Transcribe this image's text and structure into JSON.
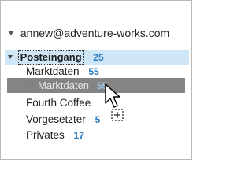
{
  "account": {
    "email": "annew@adventure-works.com",
    "expand_icon": "chevron-down-icon"
  },
  "inbox": {
    "label": "Posteingang",
    "count": "25",
    "selected": true,
    "highlight_color": "#cfe6f7"
  },
  "folders": [
    {
      "label": "Marktdaten",
      "count": "55"
    },
    {
      "label": "Fourth Coffee",
      "count": ""
    },
    {
      "label": "Vorgesetzter",
      "count": "5"
    },
    {
      "label": "Privates",
      "count": "17"
    }
  ],
  "drag": {
    "label": "Marktdaten",
    "count": "55",
    "ghost_label_partial": "Ve",
    "cursor_icon": "move-cursor-icon"
  },
  "colors": {
    "count_blue": "#2b7cc3",
    "drag_bar": "#7a7a7a"
  }
}
